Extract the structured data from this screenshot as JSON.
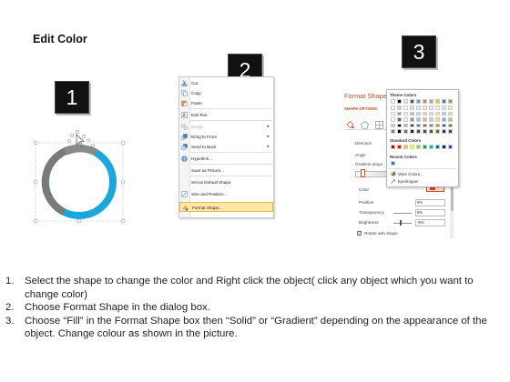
{
  "page_title": "Edit Color",
  "badges": [
    "1",
    "2",
    "3"
  ],
  "context_menu": {
    "items": [
      {
        "label": "Cut",
        "icon": "scissors-icon",
        "disabled": false
      },
      {
        "label": "Copy",
        "icon": "copy-icon",
        "disabled": false
      },
      {
        "label": "Paste",
        "icon": "paste-icon",
        "disabled": false
      },
      {
        "label": "Edit Text",
        "icon": "edit-text-icon",
        "disabled": false
      },
      {
        "label": "Group",
        "icon": "group-icon",
        "disabled": true,
        "submenu": true
      },
      {
        "label": "Bring to Front",
        "icon": "bring-front-icon",
        "disabled": false,
        "submenu": true
      },
      {
        "label": "Send to Back",
        "icon": "send-back-icon",
        "disabled": false,
        "submenu": true
      },
      {
        "label": "Hyperlink...",
        "icon": "hyperlink-icon",
        "disabled": false
      },
      {
        "label": "Save as Picture...",
        "icon": "",
        "disabled": false
      },
      {
        "label": "Set as Default Shape",
        "icon": "",
        "disabled": false
      },
      {
        "label": "Size and Position...",
        "icon": "size-icon",
        "disabled": false
      },
      {
        "label": "Format Shape...",
        "icon": "format-shape-icon",
        "disabled": false,
        "highlighted": true
      }
    ]
  },
  "format_pane": {
    "title": "Format Shape",
    "subtitle": "SHAPE OPTIONS",
    "direction_label": "Direction",
    "angle_label": "Angle",
    "gradient_stops_label": "Gradient stops",
    "color_label": "Color",
    "position_label": "Position",
    "position_value": "0%",
    "transparency_label": "Transparency",
    "transparency_value": "0%",
    "brightness_label": "Brightness",
    "brightness_value": "-5%",
    "rotate_label": "Rotate with shape"
  },
  "color_palette": {
    "theme_header": "Theme Colors",
    "standard_header": "Standard Colors",
    "recent_header": "Recent Colors",
    "more_colors": "More Colors...",
    "eyedropper": "Eyedropper",
    "theme_top": [
      "#ffffff",
      "#000000",
      "#e7e6e6",
      "#44546a",
      "#5b9bd5",
      "#ed7d31",
      "#a5a5a5",
      "#ffc000",
      "#4472c4",
      "#70ad47"
    ],
    "standard": [
      "#c00000",
      "#ff0000",
      "#ffc000",
      "#ffff00",
      "#92d050",
      "#00b050",
      "#00b0f0",
      "#0070c0",
      "#002060",
      "#7030a0"
    ],
    "recent": [
      "#2e75b6"
    ]
  },
  "instructions": [
    {
      "num": "1.",
      "text": "Select the shape to change the color and Right click the object( click any object which you want to change color)"
    },
    {
      "num": "2.",
      "text": "Choose Format Shape in the dialog box."
    },
    {
      "num": "3.",
      "text": "Choose “Fill” in the Format Shape box then “Solid” or “Gradient” depending on the appearance of the object. Change colour as shown in the picture."
    }
  ],
  "colors": {
    "ring_blue": "#1aa7de",
    "ring_gray": "#7a7a7a",
    "accent_orange": "#d24726",
    "menu_highlight": "#fde6a8"
  }
}
